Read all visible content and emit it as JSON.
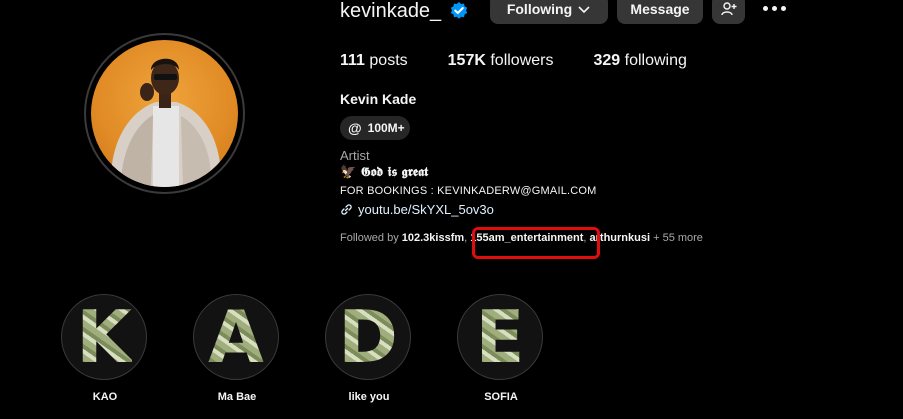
{
  "profile": {
    "username": "kevinkade_",
    "full_name": "Kevin Kade",
    "threads_count": "100M+",
    "category": "Artist",
    "bio_line1": "🦅 𝕲𝖔𝖉 𝖎𝖘 𝖌𝖗𝖊𝖆𝖙",
    "bio_line2": "FOR BOOKINGS : KEVINKADERW@GMAIL.COM",
    "link": "youtu.be/SkYXL_5ov3o"
  },
  "actions": {
    "following_label": "Following",
    "message_label": "Message"
  },
  "stats": {
    "posts_value": "111",
    "posts_label": "posts",
    "followers_value": "157K",
    "followers_label": "followers",
    "following_value": "329",
    "following_label": "following"
  },
  "followed_by": {
    "prefix": "Followed by ",
    "users": [
      "102.3kissfm",
      "155am_entertainment",
      "arthurnkusi"
    ],
    "more": "+ 55 more"
  },
  "highlights": [
    {
      "label": "KAO",
      "letter": "K"
    },
    {
      "label": "Ma Bae",
      "letter": "A"
    },
    {
      "label": "like you",
      "letter": "D"
    },
    {
      "label": "SOFIA",
      "letter": "E"
    }
  ],
  "colors": {
    "background": "#000000",
    "button_bg": "#363636",
    "verified_blue": "#0095f6",
    "annotation_red": "#e10d0d"
  }
}
